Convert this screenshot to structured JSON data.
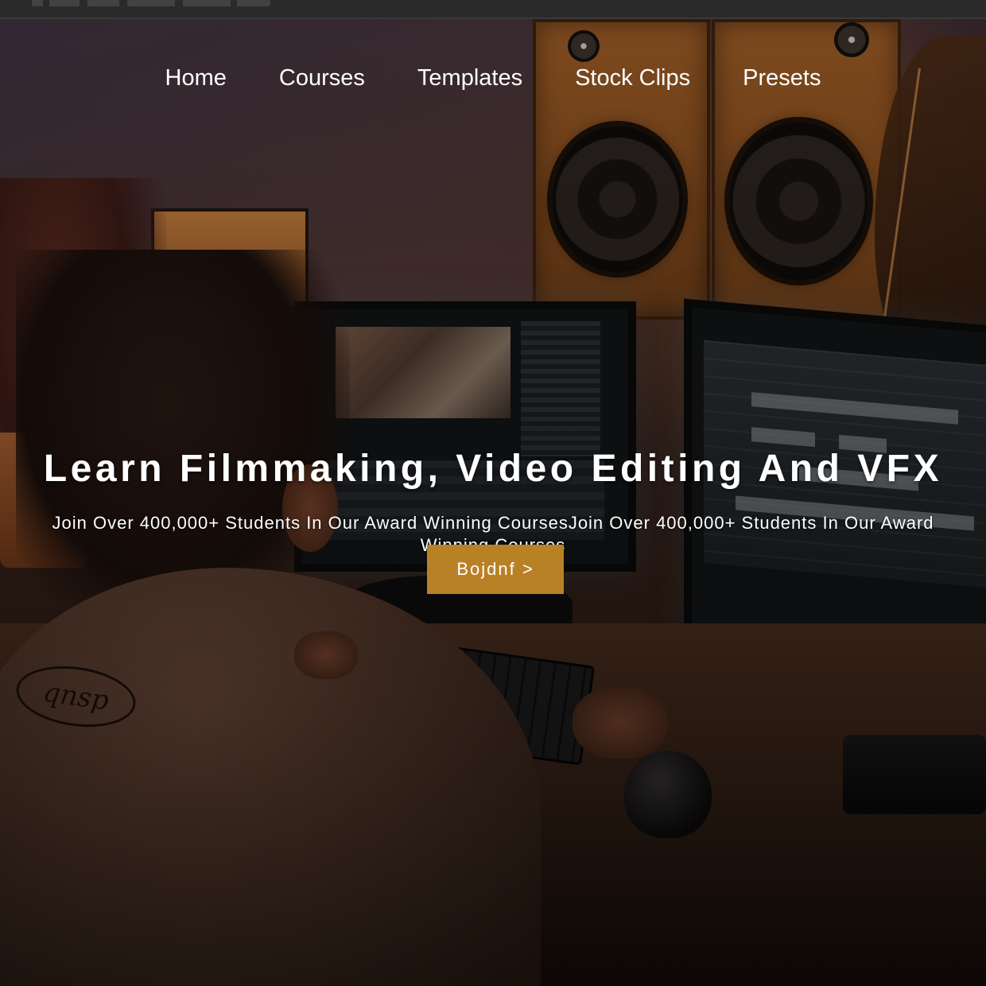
{
  "nav": {
    "items": [
      {
        "label": "Home"
      },
      {
        "label": "Courses"
      },
      {
        "label": "Templates"
      },
      {
        "label": "Stock Clips"
      },
      {
        "label": "Presets"
      }
    ]
  },
  "hero": {
    "headline": "Learn Filmmaking, Video Editing And VFX",
    "subline_row1": "Join Over 400,000+ Students In Our Award Winning CoursesJoin Over 400,000+ Students In Our Award",
    "subline_row2": "Winning Courses",
    "cta_label": "Bojdnf >",
    "shirt_logo_text": "qnsp"
  },
  "colors": {
    "cta_background": "#b98126",
    "text": "#ffffff",
    "browser_bar": "#2a2a2a"
  }
}
